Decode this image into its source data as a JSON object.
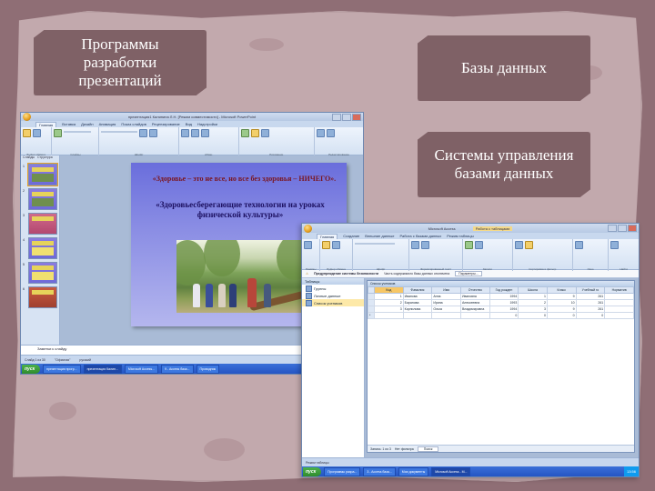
{
  "labels": {
    "presentation_programs": "Программы разработки презентаций",
    "databases": "Базы данных",
    "dbms": "Системы управления базами данных"
  },
  "colors": {
    "background": "#8f6e75",
    "paper": "#c2a9ad",
    "label_box": "#7f6166",
    "label_text": "#ffffff"
  },
  "ppt": {
    "window_title": "презентация1 Калинина Л.Н. [Режим совместимости] - Microsoft PowerPoint",
    "ribbon_tabs": [
      "Главная",
      "Вставка",
      "Дизайн",
      "Анимация",
      "Показ слайдов",
      "Рецензирование",
      "Вид",
      "Надстройки"
    ],
    "ribbon_groups": [
      "Буфер обмена",
      "Слайды",
      "Шрифт",
      "Абзац",
      "Рисование",
      "Редактирование"
    ],
    "panel_tabs": [
      "Слайды",
      "Структура"
    ],
    "slide_numbers": [
      "1",
      "2",
      "3",
      "4",
      "5",
      "6"
    ],
    "slide_quote": "«Здоровье – это не все, но все без здоровья – НИЧЕГО».",
    "slide_title": "«Здоровьесберегающие технологии на уроках физической культуры»",
    "notes_placeholder": "Заметки к слайду",
    "status": [
      "Слайд 1 из 30",
      "\"Офисная\"",
      "русский"
    ],
    "taskbar": {
      "start": "пуск",
      "buttons": [
        "презентация прогр...",
        "презентация Калин...",
        "Microsoft Access...",
        "9 - Access база...",
        "Проводник"
      ],
      "tray": "14:00"
    }
  },
  "access": {
    "window_title": "Microsoft Access",
    "context_title": "Работа с таблицами",
    "ribbon_tabs": [
      "Главная",
      "Создание",
      "Внешние данные",
      "Работа с базами данных",
      "Режим таблицы"
    ],
    "ribbon_groups": [
      "Режимы",
      "Буфер обмена",
      "Шрифт",
      "Форматированный текст",
      "Записи",
      "Сортировка и фильтр",
      "Окно",
      "Найти"
    ],
    "message": "Предупреждение системы безопасности",
    "message_detail": "Часть содержимого базы данных отключена",
    "message_button": "Параметры...",
    "nav_header": "Таблицы",
    "nav_items": [
      "Группы",
      "Личные данные",
      "Список учеников"
    ],
    "table_title": "Список учеников",
    "columns": [
      "Код",
      "Фамилия",
      "Имя",
      "Отчество",
      "Год рожден",
      "Школа",
      "Класс",
      "Учебный го",
      "Норматив"
    ],
    "rows": [
      [
        "1",
        "Иванова",
        "Анна",
        "Ивановна",
        "1994",
        "1",
        "9",
        "261",
        ""
      ],
      [
        "2",
        "Баранова",
        "Ирина",
        "Алексеевна",
        "1993",
        "2",
        "10",
        "261",
        ""
      ],
      [
        "3",
        "Корнилова",
        "Ольга",
        "Владимировна",
        "1994",
        "3",
        "9",
        "261",
        ""
      ],
      [
        "*",
        "",
        "",
        "",
        "0",
        "0",
        "0",
        "0",
        ""
      ]
    ],
    "record_nav": "Запись: 1 из 3",
    "filter_label": "Нет фильтра",
    "search_label": "Поиск",
    "status": "Режим таблицы",
    "taskbar": {
      "start": "пуск",
      "buttons": [
        "Программы разра...",
        "3 - Access база...",
        "Мои документы",
        "Microsoft Access - M..."
      ],
      "tray": "13:56"
    }
  }
}
